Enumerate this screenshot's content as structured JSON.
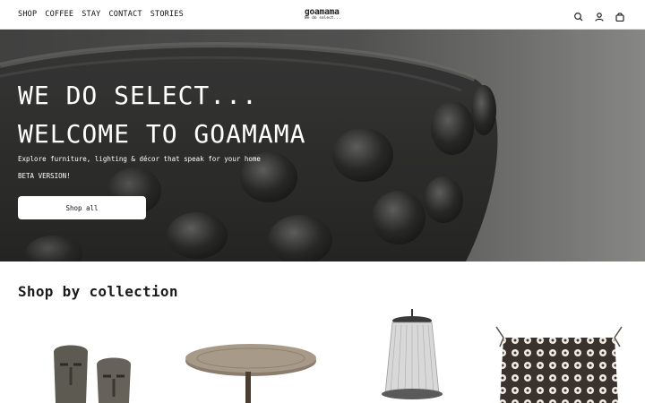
{
  "nav": {
    "items": [
      "SHOP",
      "COFFEE",
      "STAY",
      "CONTACT",
      "STORIES"
    ]
  },
  "logo": {
    "name": "goamama",
    "tagline": "We do select..."
  },
  "header_icons": [
    "search-icon",
    "account-icon",
    "cart-icon"
  ],
  "hero": {
    "line1": "WE DO SELECT...",
    "line2": "WELCOME TO GOAMAMA",
    "subtitle": "Explore furniture, lighting & décor that speak for your home",
    "beta": "BETA VERSION!",
    "button_label": "Shop all"
  },
  "collection": {
    "title": "Shop by collection",
    "items": [
      "masks",
      "table",
      "chandelier",
      "cushion"
    ]
  },
  "colors": {
    "hero_bg": "#6f6f6d",
    "text": "#1a1a1a",
    "button_bg": "#ffffff"
  }
}
